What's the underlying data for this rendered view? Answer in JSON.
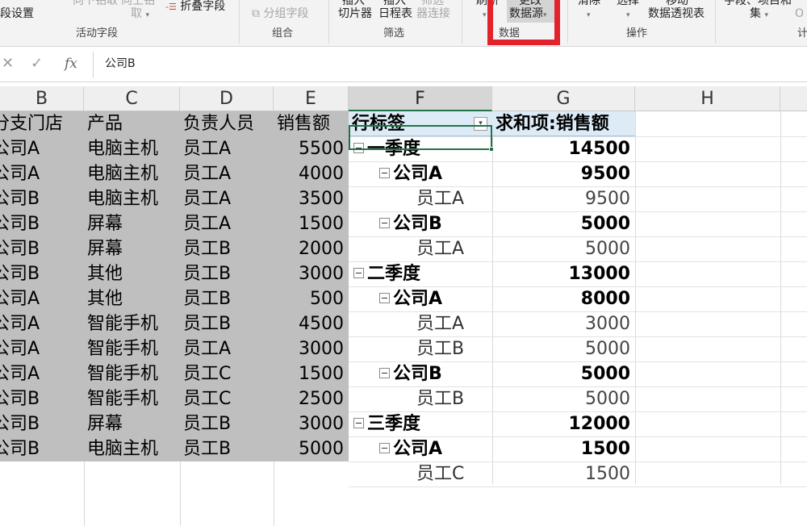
{
  "ribbon": {
    "field_settings": "段设置",
    "drill_down": "向下钻取",
    "drill_up": "向上钻",
    "drill_up2": "取",
    "collapse_field": "折叠字段",
    "active_field_group": "活动字段",
    "group_field": "分组字段",
    "group_group": "组合",
    "insert_slicer_top": "插入",
    "insert_slicer": "切片器",
    "insert_timeline_top": "插入",
    "insert_timeline": "日程表",
    "filter_conn_top": "筛选",
    "filter_conn": "器连接",
    "filter_group": "筛选",
    "refresh": "刷新",
    "change_source_top": "更改",
    "change_source": "数据源",
    "data_group": "数据",
    "clear": "清除",
    "select": "选择",
    "move_top": "移动",
    "move_pivot": "数据透视表",
    "actions_group": "操作",
    "fields_items_top": "字段、项目和",
    "fields_items": "集",
    "calc_group": "计"
  },
  "formula_bar": {
    "cancel_glyph": "✕",
    "enter_glyph": "✓",
    "fx": "fx",
    "value": "公司B"
  },
  "columns": [
    "B",
    "C",
    "D",
    "E",
    "F",
    "G",
    "H"
  ],
  "source_table": {
    "headers": [
      "分支门店",
      "产品",
      "负责人员",
      "销售额"
    ],
    "rows": [
      [
        "公司A",
        "电脑主机",
        "员工A",
        "5500"
      ],
      [
        "公司A",
        "电脑主机",
        "员工A",
        "4000"
      ],
      [
        "公司B",
        "电脑主机",
        "员工A",
        "3500"
      ],
      [
        "公司B",
        "屏幕",
        "员工A",
        "1500"
      ],
      [
        "公司B",
        "屏幕",
        "员工B",
        "2000"
      ],
      [
        "公司B",
        "其他",
        "员工B",
        "3000"
      ],
      [
        "公司A",
        "其他",
        "员工B",
        "500"
      ],
      [
        "公司A",
        "智能手机",
        "员工B",
        "4500"
      ],
      [
        "公司A",
        "智能手机",
        "员工A",
        "3000"
      ],
      [
        "公司A",
        "智能手机",
        "员工C",
        "1500"
      ],
      [
        "公司B",
        "智能手机",
        "员工C",
        "2500"
      ],
      [
        "公司B",
        "屏幕",
        "员工B",
        "3000"
      ],
      [
        "公司B",
        "电脑主机",
        "员工B",
        "5000"
      ]
    ]
  },
  "pivot": {
    "row_label_header": "行标签",
    "sum_header": "求和项:销售额",
    "rows": [
      {
        "level": 0,
        "label": "一季度",
        "value": "14500",
        "bold": true,
        "expand": true
      },
      {
        "level": 1,
        "label": "公司A",
        "value": "9500",
        "bold": true,
        "expand": true
      },
      {
        "level": 2,
        "label": "员工A",
        "value": "9500",
        "bold": false,
        "expand": false
      },
      {
        "level": 1,
        "label": "公司B",
        "value": "5000",
        "bold": true,
        "expand": true
      },
      {
        "level": 2,
        "label": "员工A",
        "value": "5000",
        "bold": false,
        "expand": false
      },
      {
        "level": 0,
        "label": "二季度",
        "value": "13000",
        "bold": true,
        "expand": true
      },
      {
        "level": 1,
        "label": "公司A",
        "value": "8000",
        "bold": true,
        "expand": true
      },
      {
        "level": 2,
        "label": "员工A",
        "value": "3000",
        "bold": false,
        "expand": false
      },
      {
        "level": 2,
        "label": "员工B",
        "value": "5000",
        "bold": false,
        "expand": false
      },
      {
        "level": 1,
        "label": "公司B",
        "value": "5000",
        "bold": true,
        "expand": true
      },
      {
        "level": 2,
        "label": "员工B",
        "value": "5000",
        "bold": false,
        "expand": false
      },
      {
        "level": 0,
        "label": "三季度",
        "value": "12000",
        "bold": true,
        "expand": true
      },
      {
        "level": 1,
        "label": "公司A",
        "value": "1500",
        "bold": true,
        "expand": true
      },
      {
        "level": 2,
        "label": "员工C",
        "value": "1500",
        "bold": false,
        "expand": false
      }
    ]
  },
  "colors": {
    "highlight_box": "#e3232b",
    "source_fill": "#bfbfbf",
    "pivot_header_fill": "#ddebf7",
    "selection": "#217346"
  }
}
